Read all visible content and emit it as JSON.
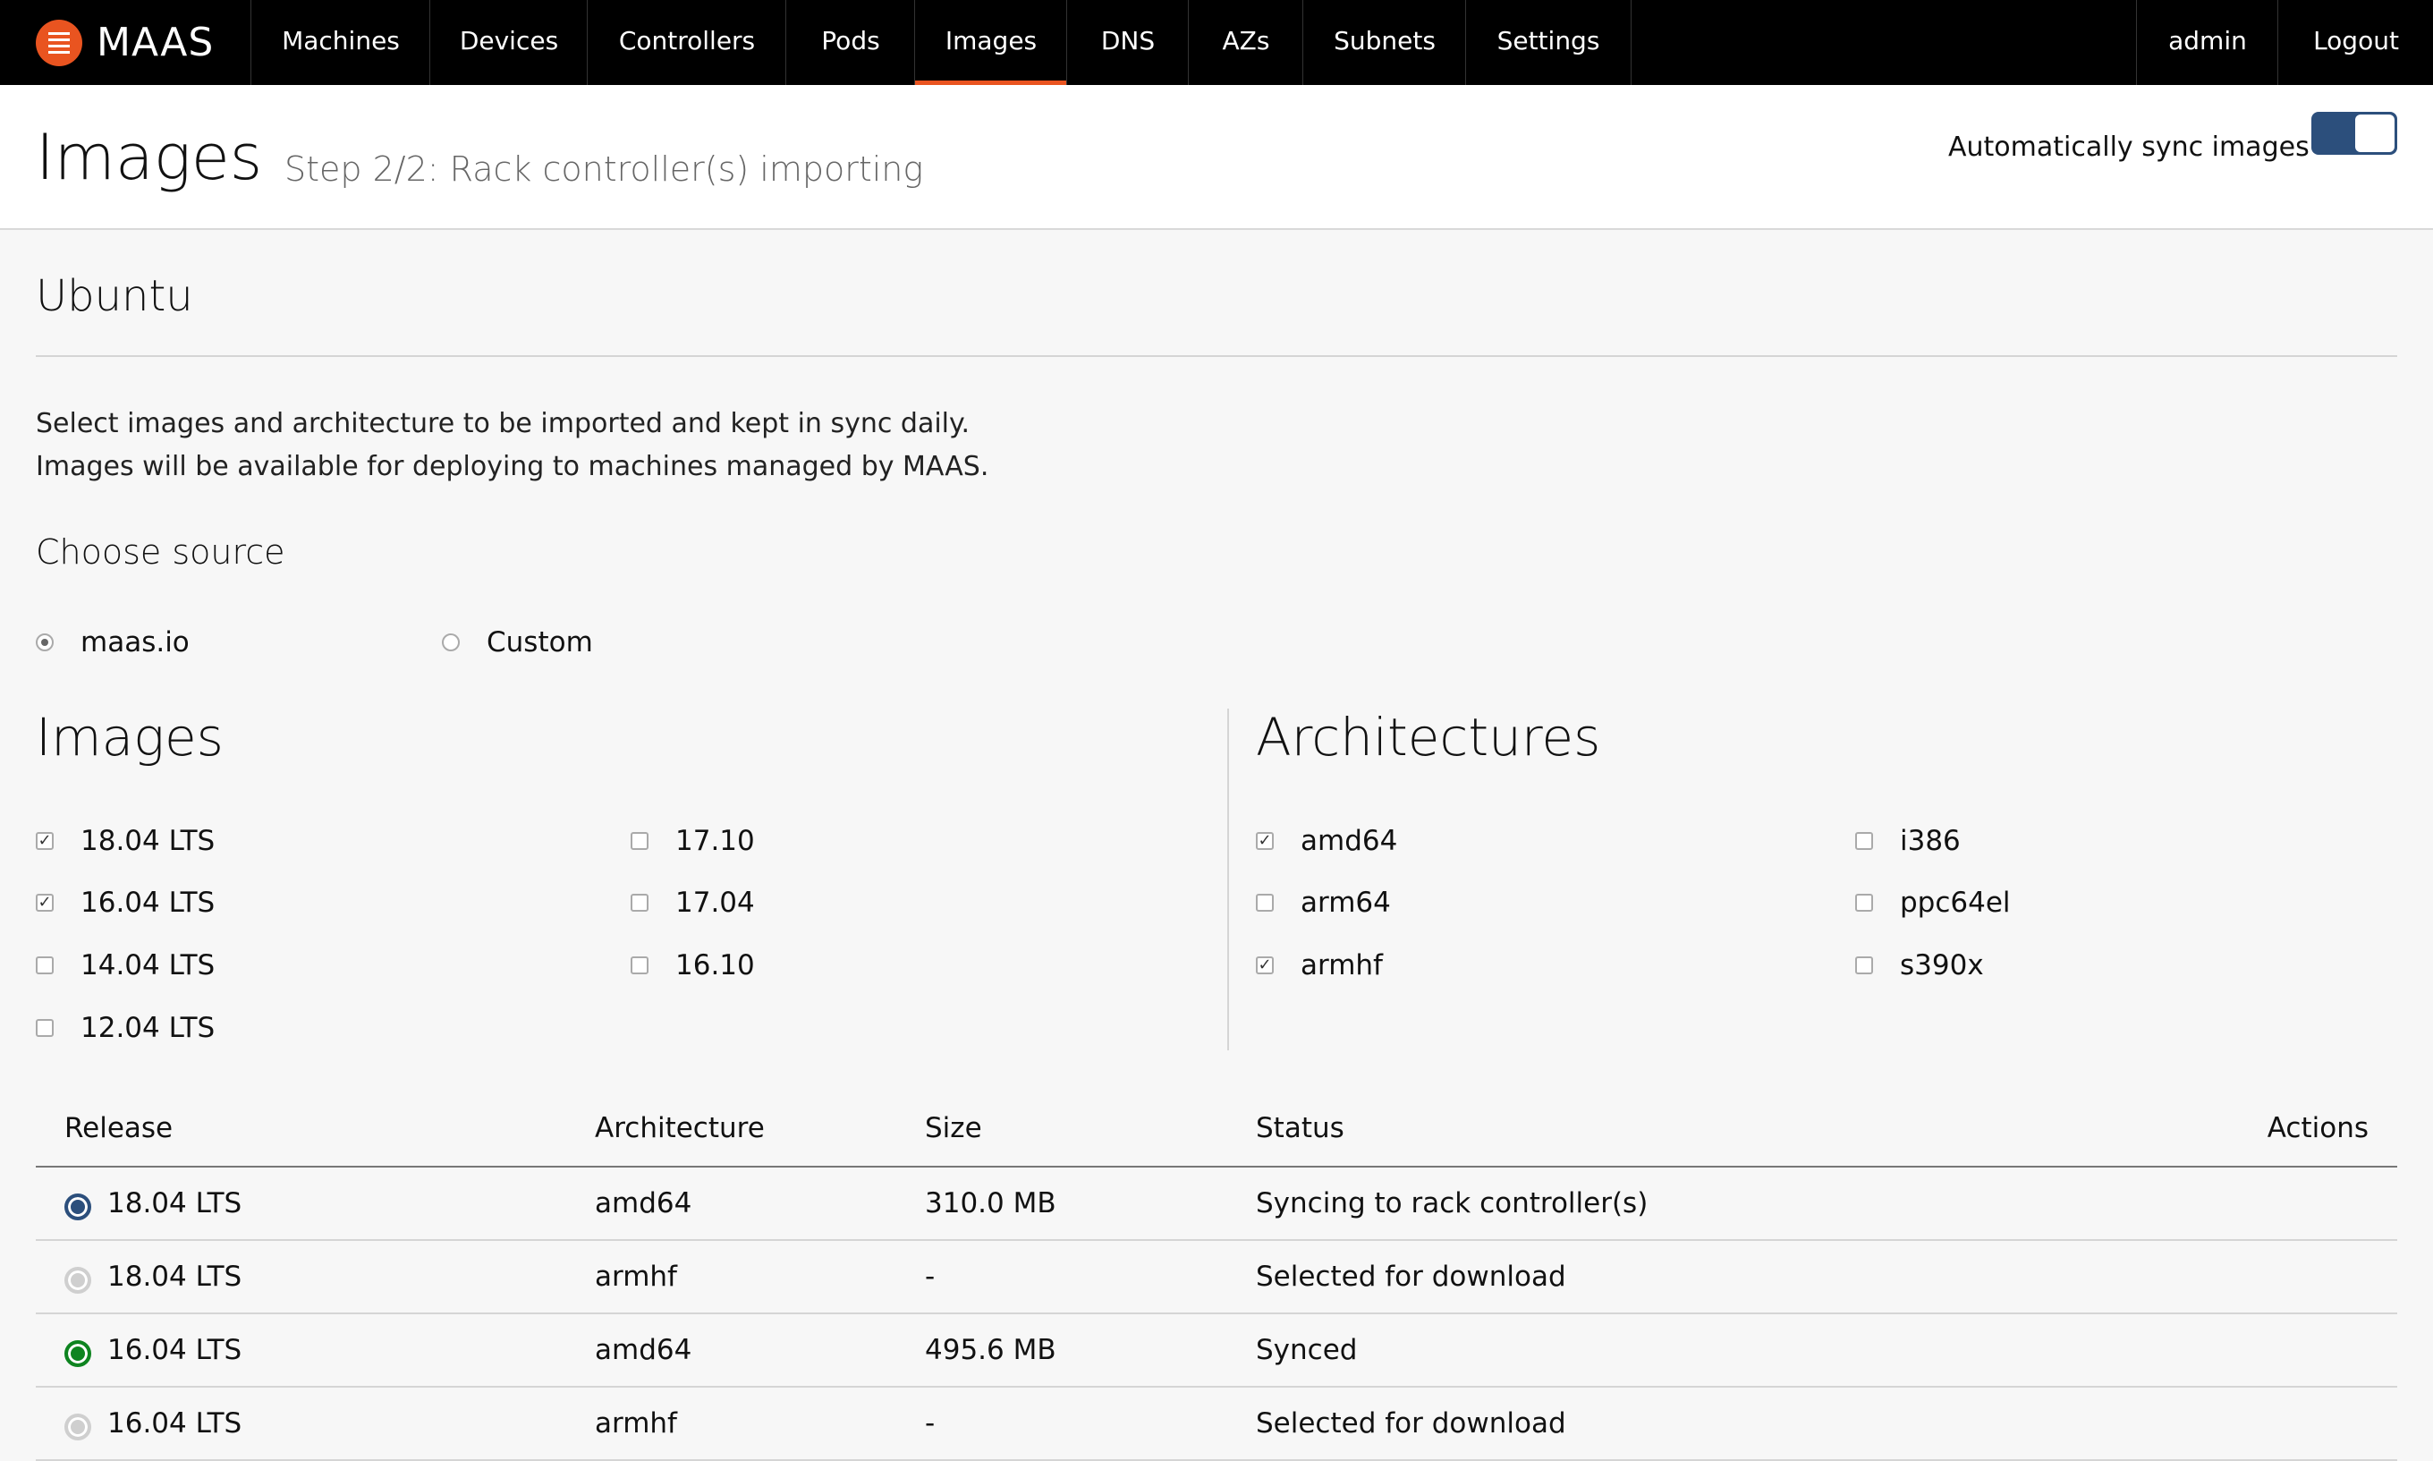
{
  "nav": {
    "brand": "MAAS",
    "items": [
      "Machines",
      "Devices",
      "Controllers",
      "Pods",
      "Images",
      "DNS",
      "AZs",
      "Subnets",
      "Settings"
    ],
    "active": "Images",
    "user": "admin",
    "logout": "Logout",
    "accent_color": "#e95420"
  },
  "header": {
    "title": "Images",
    "subtitle": "Step 2/2: Rack controller(s) importing",
    "sync_label": "Automatically sync images",
    "sync_enabled": true
  },
  "ubuntu": {
    "title": "Ubuntu",
    "description": "Select images and architecture to be imported and kept in sync daily. Images will be available for deploying to machines managed by MAAS."
  },
  "source": {
    "title": "Choose source",
    "options": [
      {
        "label": "maas.io",
        "checked": true
      },
      {
        "label": "Custom",
        "checked": false
      }
    ]
  },
  "images": {
    "title": "Images",
    "items": [
      {
        "label": "18.04 LTS",
        "checked": true
      },
      {
        "label": "16.04 LTS",
        "checked": true
      },
      {
        "label": "14.04 LTS",
        "checked": false
      },
      {
        "label": "12.04 LTS",
        "checked": false
      },
      {
        "label": "17.10",
        "checked": false
      },
      {
        "label": "17.04",
        "checked": false
      },
      {
        "label": "16.10",
        "checked": false
      }
    ]
  },
  "architectures": {
    "title": "Architectures",
    "items": [
      {
        "label": "amd64",
        "checked": true
      },
      {
        "label": "arm64",
        "checked": false
      },
      {
        "label": "armhf",
        "checked": true
      },
      {
        "label": "i386",
        "checked": false
      },
      {
        "label": "ppc64el",
        "checked": false
      },
      {
        "label": "s390x",
        "checked": false
      }
    ]
  },
  "table": {
    "headers": {
      "release": "Release",
      "architecture": "Architecture",
      "size": "Size",
      "status": "Status",
      "actions": "Actions"
    },
    "rows": [
      {
        "release": "18.04 LTS",
        "architecture": "amd64",
        "size": "310.0 MB",
        "status": "Syncing to rack controller(s)",
        "state": "syncing"
      },
      {
        "release": "18.04 LTS",
        "architecture": "armhf",
        "size": "-",
        "status": "Selected for download",
        "state": "pending"
      },
      {
        "release": "16.04 LTS",
        "architecture": "amd64",
        "size": "495.6 MB",
        "status": "Synced",
        "state": "synced"
      },
      {
        "release": "16.04 LTS",
        "architecture": "armhf",
        "size": "-",
        "status": "Selected for download",
        "state": "pending"
      }
    ]
  }
}
